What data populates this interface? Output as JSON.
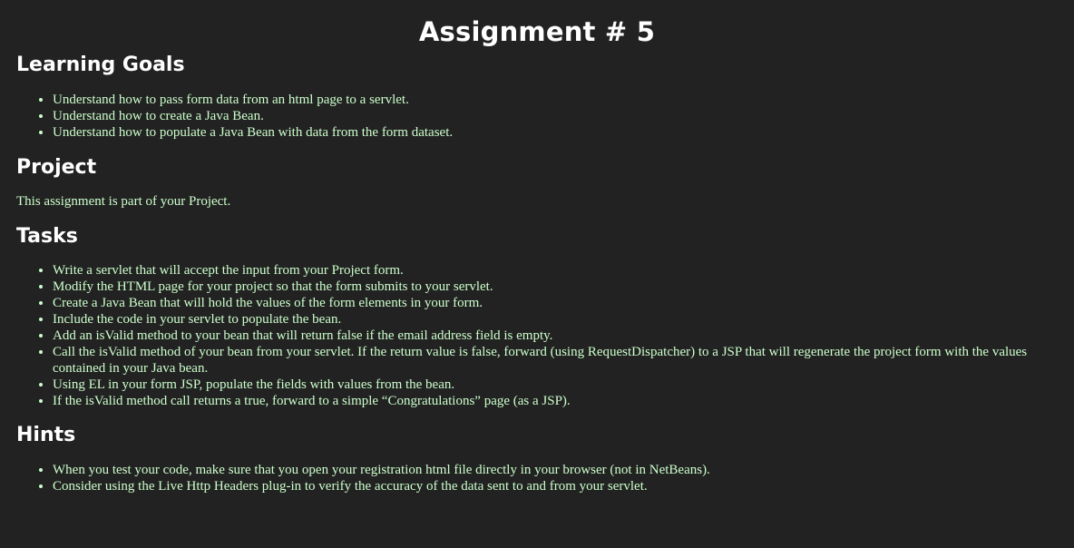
{
  "page": {
    "title": "Assignment # 5"
  },
  "learning_goals": {
    "heading": "Learning Goals",
    "items": [
      "Understand how to pass form data from an html page to a servlet.",
      "Understand how to create a Java Bean.",
      "Understand how to populate a Java Bean with data from the form dataset."
    ]
  },
  "project": {
    "heading": "Project",
    "text": "This assignment is part of your Project."
  },
  "tasks": {
    "heading": "Tasks",
    "items": [
      "Write a servlet that will accept the input from your Project form.",
      "Modify the HTML page for your project so that the form submits to your servlet.",
      "Create a Java Bean that will hold the values of the form elements in your form.",
      "Include the code in your servlet to populate the bean.",
      "Add an isValid method to your bean that will return false if the email address field is empty.",
      "Call the isValid method of your bean from your servlet. If the return value is false, forward (using RequestDispatcher) to a JSP that will regenerate the project form with the values contained in your Java bean.",
      "Using EL in your form JSP, populate the fields with values from the bean.",
      "If the isValid method call returns a true, forward to a simple “Congratulations” page (as a JSP)."
    ]
  },
  "hints": {
    "heading": "Hints",
    "items": [
      "When you test your code, make sure that you open your registration html file directly in your browser (not in NetBeans).",
      "Consider using the Live Http Headers plug-in to verify the accuracy of the data sent to and from your servlet."
    ]
  },
  "colors": {
    "background": "#222222",
    "heading": "#ffffff",
    "body_text": "#ccffcc"
  }
}
